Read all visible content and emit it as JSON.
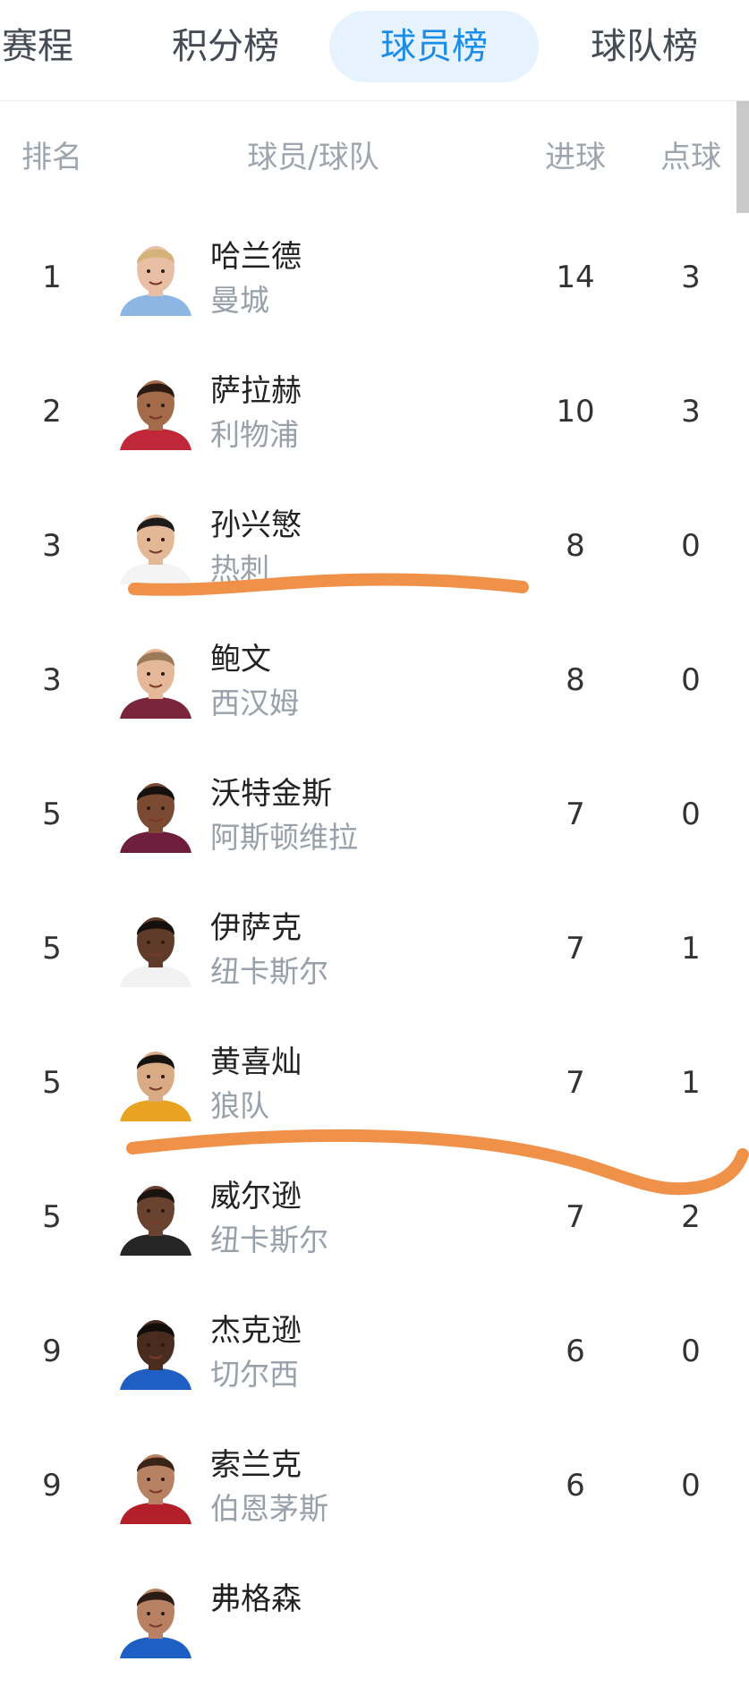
{
  "tabs": [
    {
      "label": "赛程",
      "active": false
    },
    {
      "label": "积分榜",
      "active": false
    },
    {
      "label": "球员榜",
      "active": true
    },
    {
      "label": "球队榜",
      "active": false
    }
  ],
  "table": {
    "headers": {
      "rank": "排名",
      "player": "球员/球队",
      "goals": "进球",
      "penalties": "点球"
    },
    "rows": [
      {
        "rank": "1",
        "name": "哈兰德",
        "team": "曼城",
        "goals": "14",
        "penalties": "3",
        "skin": "#e8bfa5",
        "hair": "#d4b27a",
        "shirt": "#8cb6e3"
      },
      {
        "rank": "2",
        "name": "萨拉赫",
        "team": "利物浦",
        "goals": "10",
        "penalties": "3",
        "skin": "#a46b4b",
        "hair": "#2a1a12",
        "shirt": "#c0283a"
      },
      {
        "rank": "3",
        "name": "孙兴慜",
        "team": "热刺",
        "goals": "8",
        "penalties": "0",
        "skin": "#e2b896",
        "hair": "#1d1a1a",
        "shirt": "#f4f4f4"
      },
      {
        "rank": "3",
        "name": "鲍文",
        "team": "西汉姆",
        "goals": "8",
        "penalties": "0",
        "skin": "#e4b898",
        "hair": "#9b7a58",
        "shirt": "#7a263a"
      },
      {
        "rank": "5",
        "name": "沃特金斯",
        "team": "阿斯顿维拉",
        "goals": "7",
        "penalties": "0",
        "skin": "#7a4a33",
        "hair": "#16110e",
        "shirt": "#6e1d3a"
      },
      {
        "rank": "5",
        "name": "伊萨克",
        "team": "纽卡斯尔",
        "goals": "7",
        "penalties": "1",
        "skin": "#5f3b29",
        "hair": "#15100d",
        "shirt": "#f2f2f2"
      },
      {
        "rank": "5",
        "name": "黄喜灿",
        "team": "狼队",
        "goals": "7",
        "penalties": "1",
        "skin": "#d9ab85",
        "hair": "#15120f",
        "shirt": "#e9a323"
      },
      {
        "rank": "5",
        "name": "威尔逊",
        "team": "纽卡斯尔",
        "goals": "7",
        "penalties": "2",
        "skin": "#6a4330",
        "hair": "#1a1410",
        "shirt": "#262626"
      },
      {
        "rank": "9",
        "name": "杰克逊",
        "team": "切尔西",
        "goals": "6",
        "penalties": "0",
        "skin": "#4a2c1f",
        "hair": "#100c09",
        "shirt": "#1f5fc4"
      },
      {
        "rank": "9",
        "name": "索兰克",
        "team": "伯恩茅斯",
        "goals": "6",
        "penalties": "0",
        "skin": "#b98163",
        "hair": "#3a2418",
        "shirt": "#b4202a"
      },
      {
        "rank": "",
        "name": "弗格森",
        "team": "",
        "goals": "",
        "penalties": "",
        "skin": "#b98163",
        "hair": "#2a1c14",
        "shirt": "#1e5fc3"
      }
    ]
  },
  "colors": {
    "accent": "#1b8de6",
    "tab_active_bg": "#e6f3ff",
    "annotation": "#f0914a"
  }
}
